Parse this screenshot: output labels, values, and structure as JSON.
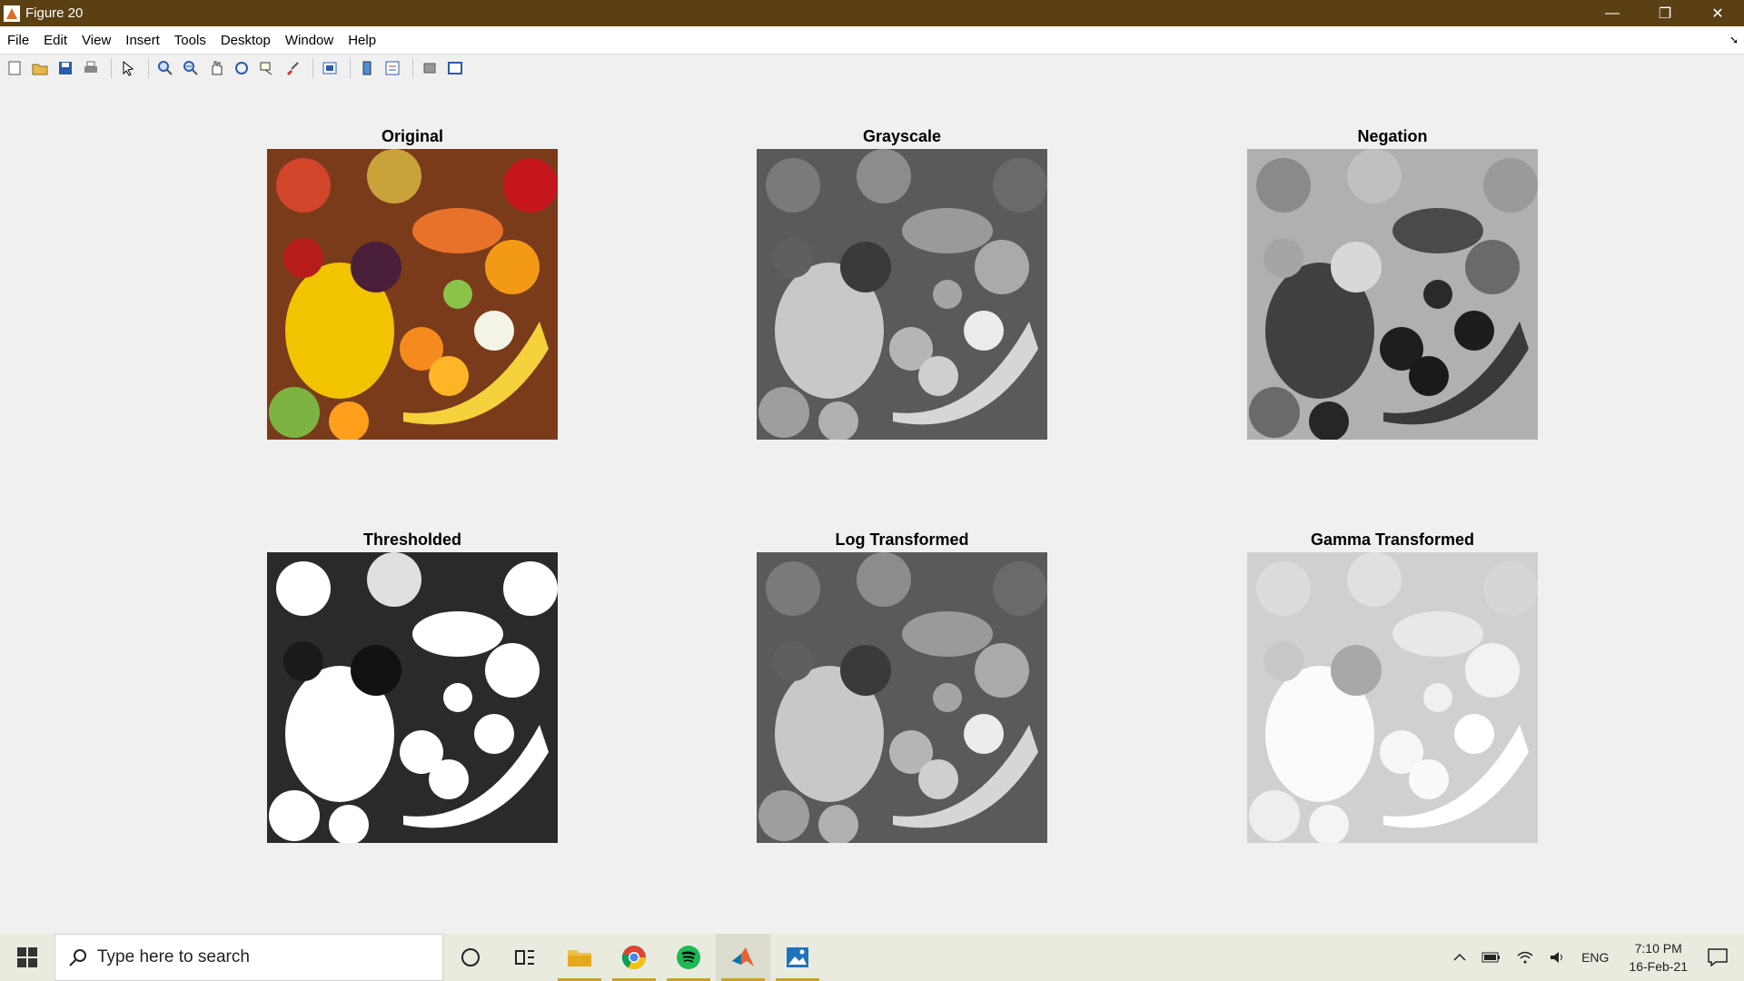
{
  "window": {
    "title": "Figure 20",
    "minimize": "—",
    "restore": "❐",
    "close": "✕"
  },
  "menu": [
    "File",
    "Edit",
    "View",
    "Insert",
    "Tools",
    "Desktop",
    "Window",
    "Help"
  ],
  "toolbar": {
    "icons": [
      "new-figure-icon",
      "open-file-icon",
      "save-icon",
      "print-icon",
      "pointer-icon",
      "zoom-in-icon",
      "zoom-out-icon",
      "pan-icon",
      "rotate-3d-icon",
      "data-cursor-icon",
      "brush-icon",
      "link-plot-icon",
      "colorbar-icon",
      "legend-icon",
      "hide-plot-tools-icon",
      "show-plot-tools-icon"
    ]
  },
  "subplots": [
    {
      "title": "Original",
      "style": "color"
    },
    {
      "title": "Grayscale",
      "style": "gray"
    },
    {
      "title": "Negation",
      "style": "negative"
    },
    {
      "title": "Thresholded",
      "style": "threshold"
    },
    {
      "title": "Log Transformed",
      "style": "gray"
    },
    {
      "title": "Gamma Transformed",
      "style": "light"
    }
  ],
  "taskbar": {
    "search_placeholder": "Type here to search",
    "apps": [
      "cortana-icon",
      "task-view-icon",
      "file-explorer-icon",
      "chrome-icon",
      "spotify-icon",
      "matlab-icon",
      "photos-icon"
    ],
    "language": "ENG",
    "time": "7:10 PM",
    "date": "16-Feb-21"
  }
}
